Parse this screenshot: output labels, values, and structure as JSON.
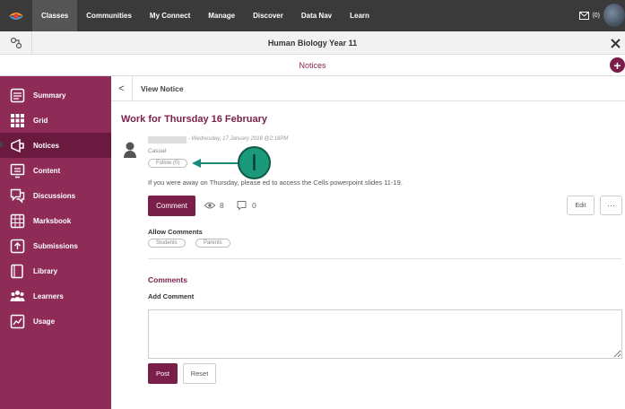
{
  "topnav": {
    "items": [
      "Classes",
      "Communities",
      "My Connect",
      "Manage",
      "Discover",
      "Data Nav",
      "Learn"
    ],
    "mail_count": "(0)"
  },
  "titlebar": {
    "title": "Human Biology Year 11"
  },
  "sectionbar": {
    "title": "Notices"
  },
  "sidebar": {
    "items": [
      {
        "label": "Summary",
        "icon": "summary-icon"
      },
      {
        "label": "Grid",
        "icon": "grid-icon"
      },
      {
        "label": "Notices",
        "icon": "notices-icon"
      },
      {
        "label": "Content",
        "icon": "content-icon"
      },
      {
        "label": "Discussions",
        "icon": "discussions-icon"
      },
      {
        "label": "Marksbook",
        "icon": "marksbook-icon"
      },
      {
        "label": "Submissions",
        "icon": "submissions-icon"
      },
      {
        "label": "Library",
        "icon": "library-icon"
      },
      {
        "label": "Learners",
        "icon": "learners-icon"
      },
      {
        "label": "Usage",
        "icon": "usage-icon"
      }
    ]
  },
  "main": {
    "header": "View Notice",
    "notice_title": "Work for Thursday 16 February",
    "meta_date": "- Wednesday, 17 January 2018 @2:18PM",
    "meta_type": "Casual",
    "follow_label": "Follow (0)",
    "marker": "I",
    "body": "If you were away on Thursday, please ed to access the Cells powerpoint slides 11-19.",
    "comment_button": "Comment",
    "views": "8",
    "comments_count": "0",
    "edit_button": "Edit",
    "more_button": "···",
    "allow_comments_label": "Allow Comments",
    "allow_options": [
      "Students",
      "Parents"
    ],
    "comments_title": "Comments",
    "add_comment_label": "Add Comment",
    "post_button": "Post",
    "reset_button": "Reset"
  },
  "colors": {
    "sidebar": "#8e2b57",
    "sidebar_active": "#6a1a3e",
    "accent": "#7a1f4a",
    "topnav": "#3a3a3a",
    "marker": "#1a9a7a"
  }
}
